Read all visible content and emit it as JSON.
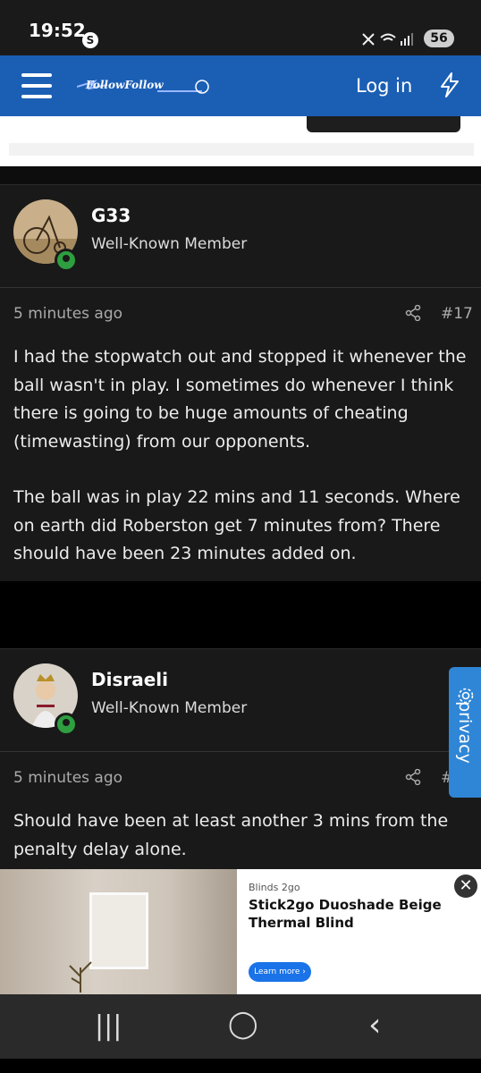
{
  "status_bar": {
    "time": "19:52",
    "battery": "56"
  },
  "header": {
    "site_name": "FollowFollow",
    "login_label": "Log in"
  },
  "posts": [
    {
      "username": "G33",
      "role": "Well-Known Member",
      "time": "5 minutes ago",
      "number": "#17",
      "body": [
        "I had the stopwatch out and stopped it whenever the ball wasn't in play. I sometimes do whenever I think there is going to be huge amounts of cheating (timewasting) from our opponents.",
        "The ball was in play 22 mins and 11 seconds. Where on earth did Roberston get 7 minutes from? There should have been 23 minutes added on."
      ]
    },
    {
      "username": "Disraeli",
      "role": "Well-Known Member",
      "time": "5 minutes ago",
      "number": "#",
      "body": [
        "Should have been at least another 3 mins from the penalty delay alone."
      ]
    }
  ],
  "privacy": {
    "label": "privacy"
  },
  "ad": {
    "brand": "Blinds 2go",
    "title": "Stick2go Duoshade Beige Thermal Blind",
    "cta": "Learn more ›"
  },
  "navbar": {
    "recent": "|||",
    "home": "◯",
    "back": "‹"
  },
  "colors": {
    "header_blue": "#1b5fb5",
    "online_green": "#2e9e40",
    "privacy_blue": "#2f86d6"
  }
}
